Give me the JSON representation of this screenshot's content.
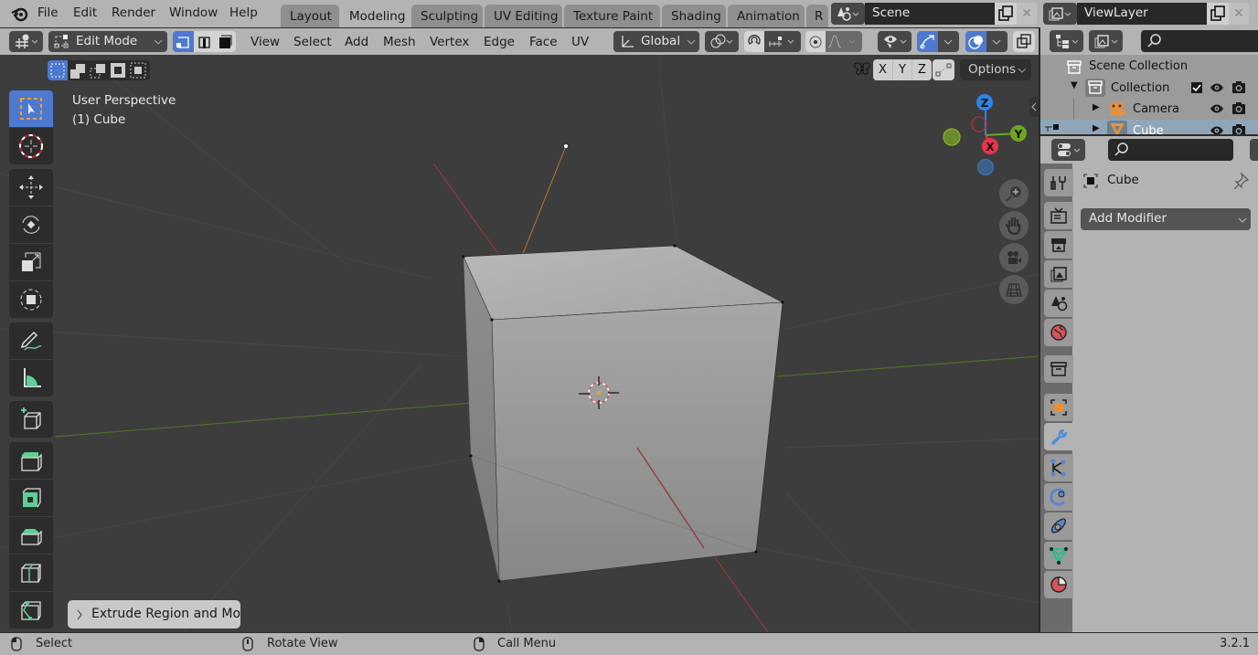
{
  "menubar": {
    "items": [
      "File",
      "Edit",
      "Render",
      "Window",
      "Help"
    ]
  },
  "workspace_tabs": [
    {
      "label": "Layout",
      "active": false
    },
    {
      "label": "Modeling",
      "active": true
    },
    {
      "label": "Sculpting",
      "active": false
    },
    {
      "label": "UV Editing",
      "active": false
    },
    {
      "label": "Texture Paint",
      "active": false
    },
    {
      "label": "Shading",
      "active": false
    },
    {
      "label": "Animation",
      "active": false
    },
    {
      "label": "R",
      "active": false
    }
  ],
  "scene": {
    "name": "Scene"
  },
  "view_layer": {
    "name": "ViewLayer"
  },
  "viewport_header": {
    "mode": "Edit Mode",
    "menus": [
      "View",
      "Select",
      "Add",
      "Mesh",
      "Vertex",
      "Edge",
      "Face",
      "UV"
    ],
    "transform_orientation": "Global",
    "mirror_axes": [
      "X",
      "Y",
      "Z"
    ],
    "options_label": "Options"
  },
  "viewport": {
    "view_name": "User Perspective",
    "object_info": "(1) Cube",
    "gizmo_axes": {
      "z": "Z",
      "y": "Y",
      "x": "X"
    },
    "last_operator": "Extrude Region and Mo"
  },
  "outliner": {
    "root": "Scene Collection",
    "items": [
      {
        "label": "Collection",
        "level": 1,
        "expanded": true
      },
      {
        "label": "Camera",
        "level": 2
      },
      {
        "label": "Cube",
        "level": 2,
        "selected": true
      }
    ]
  },
  "properties": {
    "object_name": "Cube",
    "add_modifier_label": "Add Modifier"
  },
  "statusbar": {
    "left_click": "Select",
    "middle_click": "Rotate View",
    "right_click": "Call Menu",
    "version": "3.2.1"
  },
  "colors": {
    "accent_blue": "#4d7ad0",
    "axis_x": "#e8344e",
    "axis_y": "#6fa522",
    "axis_z": "#2f84e3"
  }
}
